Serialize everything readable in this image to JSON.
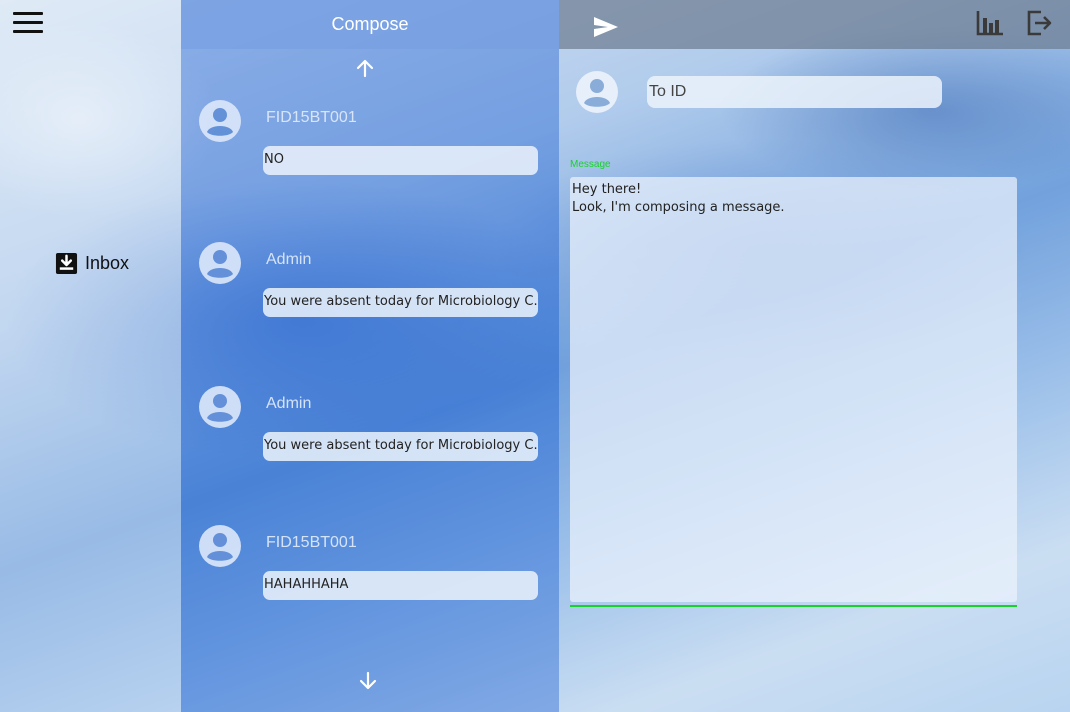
{
  "sidebar": {
    "menu_icon": "hamburger-menu-icon",
    "inbox": {
      "label": "Inbox",
      "icon": "inbox-download-icon"
    }
  },
  "list": {
    "title": "Compose",
    "messages": [
      {
        "sender": "FID15BT001",
        "preview": "NO"
      },
      {
        "sender": "Admin",
        "preview": "You were absent today for Microbiology C....."
      },
      {
        "sender": "Admin",
        "preview": "You were absent today for Microbiology C....."
      },
      {
        "sender": "FID15BT001",
        "preview": "HAHAHHAHA"
      }
    ]
  },
  "compose": {
    "send_icon": "send-icon",
    "stats_icon": "bar-chart-icon",
    "logout_icon": "logout-icon",
    "to_placeholder": "To ID",
    "message_label": "Message",
    "message_value": "Hey there!\nLook, I'm composing a message."
  },
  "colors": {
    "accent_green": "#18d12a"
  }
}
